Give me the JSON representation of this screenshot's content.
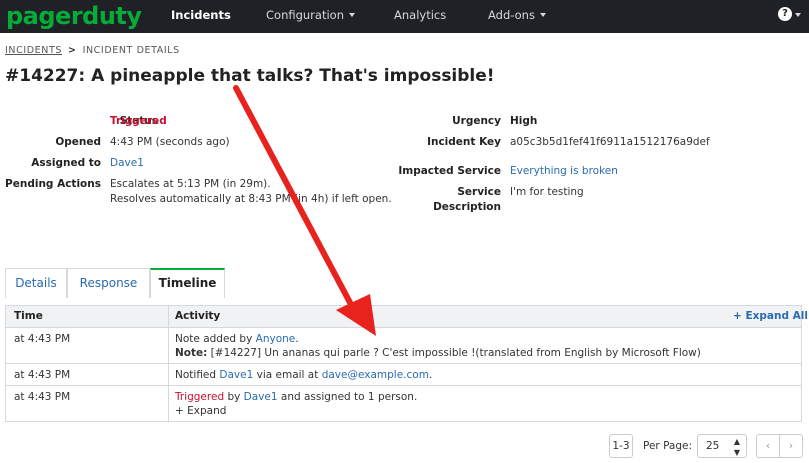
{
  "nav": {
    "logo": "pagerduty",
    "items": [
      {
        "label": "Incidents",
        "active": true
      },
      {
        "label": "Configuration",
        "dropdown": true
      },
      {
        "label": "Analytics"
      },
      {
        "label": "Add-ons",
        "dropdown": true
      }
    ],
    "help_label": "?"
  },
  "breadcrumb": {
    "parent": "INCIDENTS",
    "separator": ">",
    "current": "INCIDENT DETAILS"
  },
  "title": "#14227: A pineapple that talks? That's impossible!",
  "details": {
    "status_label": "Status",
    "status_value": "Triggered",
    "opened_label": "Opened",
    "opened_value": "4:43 PM (seconds ago)",
    "assigned_label": "Assigned to",
    "assigned_value": "Dave1",
    "pending_label": "Pending Actions",
    "pending_line1": "Escalates at 5:13 PM (in 29m).",
    "pending_line2": "Resolves automatically at 8:43 PM (in 4h) if left open.",
    "urgency_label": "Urgency",
    "urgency_value": "High",
    "key_label": "Incident Key",
    "key_value": "a05c3b5d1fef41f6911a1512176a9def",
    "service_label": "Impacted Service",
    "service_value": "Everything is broken",
    "desc_label_1": "Service",
    "desc_label_2": "Description",
    "desc_value": "I'm for testing"
  },
  "tabs": [
    {
      "label": "Details"
    },
    {
      "label": "Response"
    },
    {
      "label": "Timeline",
      "active": true
    }
  ],
  "timeline": {
    "col_time": "Time",
    "col_activity": "Activity",
    "expand_all": "+ Expand All",
    "rows": [
      {
        "time": "at 4:43 PM",
        "prefix": "Note added by ",
        "actor": "Anyone",
        "suffix": ".",
        "note_label": "Note:",
        "note_text": " [#14227] Un ananas qui parle ?  C'est impossible !(translated from English by Microsoft Flow)"
      },
      {
        "time": "at 4:43 PM",
        "prefix": "Notified ",
        "actor": "Dave1",
        "mid": " via email at ",
        "email": "dave@example.com",
        "suffix": "."
      },
      {
        "time": "at 4:43 PM",
        "status": "Triggered",
        "by": " by ",
        "actor": "Dave1",
        "suffix": " and assigned to 1 person.",
        "expand": "+ Expand"
      }
    ]
  },
  "pagination": {
    "range": "1-3",
    "per_page_label": "Per Page:",
    "per_page_value": "25",
    "prev": "‹",
    "next": "›"
  },
  "colors": {
    "brand": "#06ac38",
    "nav_bg": "#1f2127",
    "link": "#2a6bb0",
    "triggered": "#c8102e",
    "annotation_arrow": "#e8221c"
  }
}
